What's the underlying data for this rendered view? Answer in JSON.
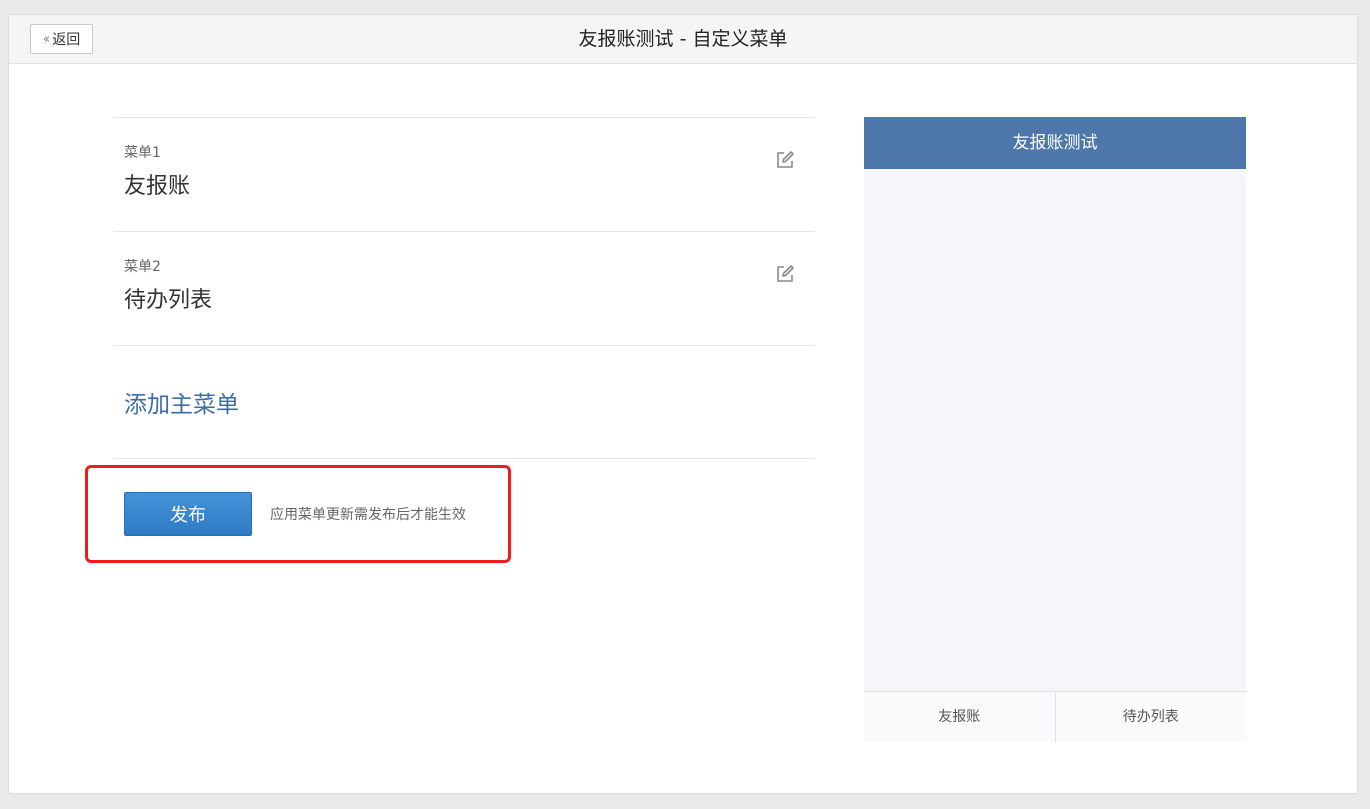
{
  "header": {
    "back_label": "返回",
    "title": "友报账测试 - 自定义菜单"
  },
  "menus": [
    {
      "index_label": "菜单1",
      "name": "友报账"
    },
    {
      "index_label": "菜单2",
      "name": "待办列表"
    }
  ],
  "add_menu_label": "添加主菜单",
  "publish": {
    "button_label": "发布",
    "tip": "应用菜单更新需发布后才能生效"
  },
  "preview": {
    "title": "友报账测试",
    "tabs": [
      "友报账",
      "待办列表"
    ]
  },
  "colors": {
    "accent": "#2f7bc4",
    "preview_header": "#4e78ab",
    "highlight": "#f01c1c",
    "link": "#3a6ea5"
  },
  "icons": {
    "back": "double-chevron-left-icon",
    "edit": "edit-icon"
  }
}
